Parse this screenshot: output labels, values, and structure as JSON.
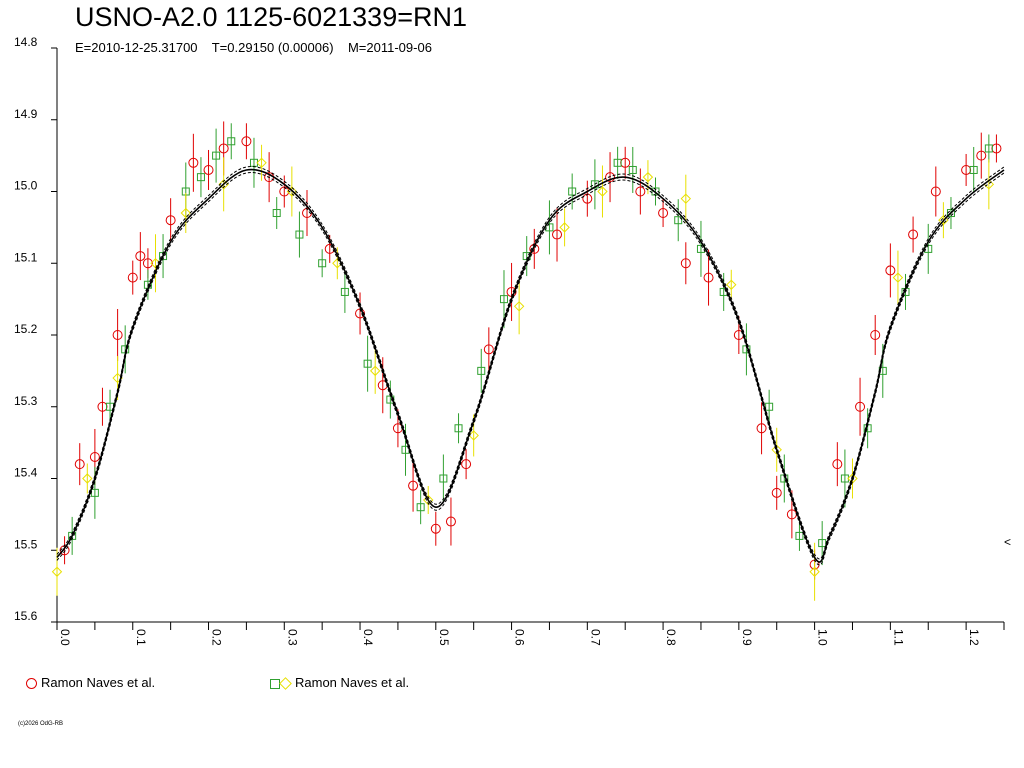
{
  "title": "USNO-A2.0 1125-6021339=RN1",
  "subtitle": "E=2010-12-25.31700    T=0.29150 (0.00006)    M=2011-09-06",
  "copyright": "(c)2026 OdG-RB",
  "right_marker": "<",
  "legend": [
    {
      "label": "Ramon Naves et al.",
      "marker": "circle-red"
    },
    {
      "label": "Ramon Naves et al.",
      "marker": "square-green-diamond-yellow"
    }
  ],
  "colors": {
    "series_red": "#e00000",
    "series_green": "#30a030",
    "series_yellow": "#e8e000",
    "fit": "#000000"
  },
  "chart_data": {
    "type": "scatter",
    "title": "USNO-A2.0 1125-6021339=RN1",
    "xlabel": "",
    "ylabel": "",
    "xlim": [
      0.0,
      1.25
    ],
    "ylim": [
      15.6,
      14.8
    ],
    "y_inverted": true,
    "x_ticks": [
      "0.0",
      "0.1",
      "0.2",
      "0.3",
      "0.4",
      "0.5",
      "0.6",
      "0.7",
      "0.8",
      "0.9",
      "1.0",
      "1.1",
      "1.2"
    ],
    "y_ticks": [
      "14.8",
      "14.9",
      "15.0",
      "15.1",
      "15.2",
      "15.3",
      "15.4",
      "15.5",
      "15.6"
    ],
    "grid": false,
    "fit_curve": {
      "x": [
        0.0,
        0.02,
        0.05,
        0.08,
        0.1,
        0.15,
        0.2,
        0.25,
        0.3,
        0.35,
        0.4,
        0.45,
        0.5,
        0.55,
        0.6,
        0.65,
        0.7,
        0.75,
        0.8,
        0.85,
        0.9,
        0.95,
        1.0,
        1.02,
        1.05,
        1.08,
        1.1,
        1.15,
        1.2,
        1.25
      ],
      "y": [
        15.51,
        15.48,
        15.4,
        15.28,
        15.19,
        15.07,
        15.01,
        14.97,
        14.99,
        15.05,
        15.16,
        15.31,
        15.44,
        15.32,
        15.15,
        15.04,
        15.0,
        14.98,
        15.01,
        15.07,
        15.18,
        15.36,
        15.51,
        15.48,
        15.4,
        15.28,
        15.19,
        15.07,
        15.01,
        14.97
      ]
    },
    "series": [
      {
        "name": "Ramon Naves et al.",
        "marker": "circle",
        "color": "#e00000",
        "x": [
          0.01,
          0.03,
          0.05,
          0.06,
          0.08,
          0.1,
          0.11,
          0.12,
          0.15,
          0.18,
          0.2,
          0.22,
          0.25,
          0.28,
          0.3,
          0.33,
          0.36,
          0.4,
          0.43,
          0.45,
          0.47,
          0.5,
          0.52,
          0.54,
          0.57,
          0.6,
          0.63,
          0.66,
          0.7,
          0.73,
          0.75,
          0.77,
          0.8,
          0.83,
          0.86,
          0.9,
          0.93,
          0.95,
          0.97,
          1.0,
          1.03,
          1.06,
          1.08,
          1.1,
          1.13,
          1.16,
          1.2,
          1.22,
          1.24
        ],
        "y": [
          15.5,
          15.38,
          15.37,
          15.3,
          15.2,
          15.12,
          15.09,
          15.1,
          15.04,
          14.96,
          14.97,
          14.94,
          14.93,
          14.98,
          15.0,
          15.03,
          15.08,
          15.17,
          15.27,
          15.33,
          15.41,
          15.47,
          15.46,
          15.38,
          15.22,
          15.14,
          15.08,
          15.06,
          15.01,
          14.98,
          14.96,
          15.0,
          15.03,
          15.1,
          15.12,
          15.2,
          15.33,
          15.42,
          15.45,
          15.52,
          15.38,
          15.3,
          15.2,
          15.11,
          15.06,
          15.0,
          14.97,
          14.95,
          14.94
        ]
      },
      {
        "name": "Ramon Naves et al.",
        "marker": "square",
        "color": "#30a030",
        "x": [
          0.02,
          0.05,
          0.07,
          0.09,
          0.12,
          0.14,
          0.17,
          0.19,
          0.21,
          0.23,
          0.26,
          0.29,
          0.32,
          0.35,
          0.38,
          0.41,
          0.44,
          0.46,
          0.48,
          0.51,
          0.53,
          0.56,
          0.59,
          0.62,
          0.65,
          0.68,
          0.71,
          0.74,
          0.76,
          0.79,
          0.82,
          0.85,
          0.88,
          0.91,
          0.94,
          0.96,
          0.98,
          1.01,
          1.04,
          1.07,
          1.09,
          1.12,
          1.15,
          1.18,
          1.21,
          1.23
        ],
        "y": [
          15.48,
          15.42,
          15.3,
          15.22,
          15.13,
          15.09,
          15.0,
          14.98,
          14.95,
          14.93,
          14.96,
          15.03,
          15.06,
          15.1,
          15.14,
          15.24,
          15.29,
          15.36,
          15.44,
          15.4,
          15.33,
          15.25,
          15.15,
          15.09,
          15.05,
          15.0,
          14.99,
          14.96,
          14.97,
          15.0,
          15.04,
          15.08,
          15.14,
          15.22,
          15.3,
          15.4,
          15.48,
          15.49,
          15.4,
          15.33,
          15.25,
          15.14,
          15.08,
          15.03,
          14.97,
          14.94
        ]
      },
      {
        "name": "Ramon Naves et al.",
        "marker": "diamond",
        "color": "#e8e000",
        "x": [
          0.0,
          0.04,
          0.08,
          0.13,
          0.17,
          0.22,
          0.27,
          0.31,
          0.37,
          0.42,
          0.49,
          0.55,
          0.61,
          0.67,
          0.72,
          0.78,
          0.83,
          0.89,
          0.95,
          1.0,
          1.05,
          1.11,
          1.17,
          1.23
        ],
        "y": [
          15.53,
          15.4,
          15.26,
          15.1,
          15.03,
          14.99,
          14.96,
          15.0,
          15.1,
          15.25,
          15.43,
          15.34,
          15.16,
          15.05,
          15.0,
          14.98,
          15.01,
          15.13,
          15.36,
          15.53,
          15.4,
          15.12,
          15.04,
          14.99
        ]
      }
    ]
  }
}
